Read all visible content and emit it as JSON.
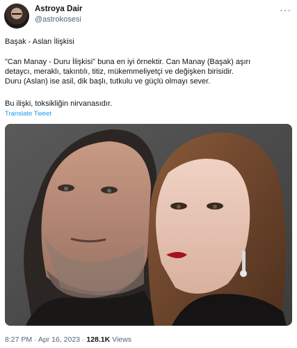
{
  "user": {
    "display_name": "Astroya Dair",
    "handle": "@astrokosesi"
  },
  "tweet": {
    "line1": "Başak - Aslan İlişkisi",
    "line2": "\"Can Manay - Duru İlişkisi\" buna en iyi örnektir. Can Manay (Başak) aşırı",
    "line3": "detaycı, meraklı, takıntılı, titiz, mükemmeliyetçi ve değişken birisidir.",
    "line4": "Duru (Aslan) ise asil, dik başlı, tutkulu ve güçlü olmayı sever.",
    "line5": "Bu ilişki, toksikliğin nirvanasıdır.",
    "translate_label": "Translate Tweet"
  },
  "meta": {
    "time": "8:27 PM",
    "sep1": " · ",
    "date": "Apr 16, 2023",
    "sep2": " · ",
    "views_count": "128.1K",
    "views_label": " Views"
  },
  "icons": {
    "more": "more-horizontal-icon"
  },
  "colors": {
    "link": "#1d9bf0",
    "muted": "#536471",
    "text": "#0f1419"
  }
}
